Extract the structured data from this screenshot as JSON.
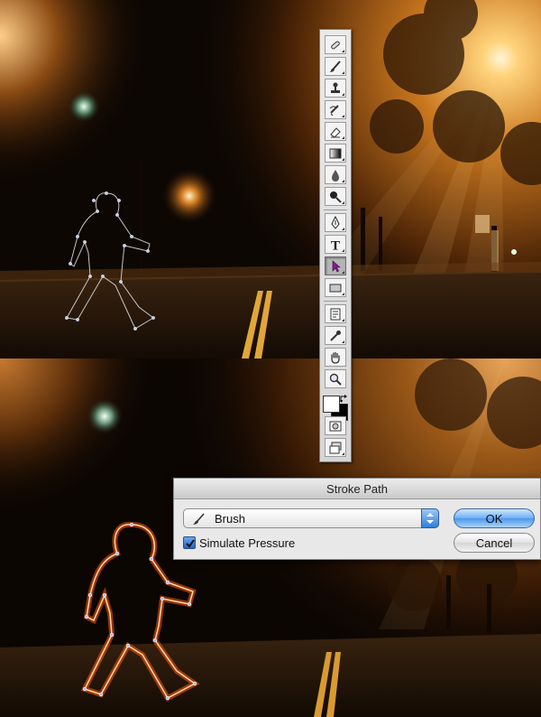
{
  "dialog": {
    "title": "Stroke Path",
    "tool_value": "Brush",
    "checkbox_label": "Simulate Pressure",
    "checkbox_checked": true,
    "ok_label": "OK",
    "cancel_label": "Cancel"
  },
  "toolbox": {
    "tools": [
      {
        "icon": "healing-brush-icon"
      },
      {
        "icon": "brush-icon"
      },
      {
        "icon": "clone-stamp-icon"
      },
      {
        "icon": "history-brush-icon"
      },
      {
        "icon": "eraser-icon"
      },
      {
        "icon": "gradient-icon"
      },
      {
        "icon": "blur-icon"
      },
      {
        "icon": "dodge-icon"
      },
      {
        "icon": "pen-icon"
      },
      {
        "icon": "type-icon",
        "glyph": "T"
      },
      {
        "icon": "path-selection-icon",
        "selected": true
      },
      {
        "icon": "rectangle-shape-icon"
      },
      {
        "icon": "notes-icon"
      },
      {
        "icon": "eyedropper-icon"
      },
      {
        "icon": "hand-icon"
      },
      {
        "icon": "zoom-icon"
      }
    ],
    "colors": {
      "foreground": "#ffffff",
      "background": "#000000"
    }
  },
  "colors": {
    "accent": "#3b8ae6",
    "path_glow": "#ff7a1a",
    "light": "#ffd58a"
  }
}
